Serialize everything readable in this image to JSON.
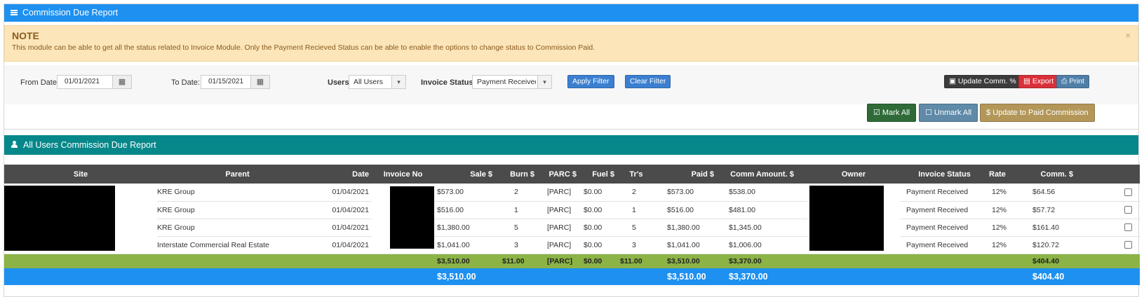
{
  "title": "Commission Due Report",
  "note": {
    "heading": "NOTE",
    "text": "This module can be able to get all the status related to Invoice Module. Only the Payment Recieved Status can be able to enable the options to change status to Commission Paid.",
    "close": "×"
  },
  "filters": {
    "from_label": "From Date:",
    "from_value": "01/01/2021",
    "to_label": "To Date:",
    "to_value": "01/15/2021",
    "users_label": "Users",
    "users_value": "All Users",
    "status_label": "Invoice Status",
    "status_value": "Payment Received",
    "apply": "Apply Filter",
    "clear": "Clear Filter",
    "update_comm": "Update Comm. %",
    "export": "Export",
    "print": "Print",
    "calendar_icon": "▦",
    "caret": "▾"
  },
  "actions": {
    "mark_all": "Mark All",
    "unmark_all": "Unmark All",
    "update_paid": "Update to Paid Commission"
  },
  "section_title": "All Users Commission Due Report",
  "table": {
    "headers": [
      "Site",
      "Parent",
      "Date",
      "Invoice No",
      "Sale $",
      "Burn $",
      "PARC $",
      "Fuel $",
      "Tr's",
      "Paid $",
      "Comm Amount. $",
      "Owner",
      "Invoice Status",
      "Rate",
      "Comm. $",
      ""
    ],
    "rows": [
      {
        "parent": "KRE Group",
        "date": "01/04/2021",
        "sale": "$573.00",
        "burn": "2",
        "parc": "[PARC]",
        "fuel": "$0.00",
        "trs": "2",
        "paid": "$573.00",
        "comm_amount": "$538.00",
        "status": "Payment Received",
        "rate": "12%",
        "comm": "$64.56"
      },
      {
        "parent": "KRE Group",
        "date": "01/04/2021",
        "sale": "$516.00",
        "burn": "1",
        "parc": "[PARC]",
        "fuel": "$0.00",
        "trs": "1",
        "paid": "$516.00",
        "comm_amount": "$481.00",
        "status": "Payment Received",
        "rate": "12%",
        "comm": "$57.72"
      },
      {
        "parent": "KRE Group",
        "date": "01/04/2021",
        "sale": "$1,380.00",
        "burn": "5",
        "parc": "[PARC]",
        "fuel": "$0.00",
        "trs": "5",
        "paid": "$1,380.00",
        "comm_amount": "$1,345.00",
        "status": "Payment Received",
        "rate": "12%",
        "comm": "$161.40"
      },
      {
        "parent": "Interstate Commercial Real Estate",
        "date": "01/04/2021",
        "sale": "$1,041.00",
        "burn": "3",
        "parc": "[PARC]",
        "fuel": "$0.00",
        "trs": "3",
        "paid": "$1,041.00",
        "comm_amount": "$1,006.00",
        "status": "Payment Received",
        "rate": "12%",
        "comm": "$120.72"
      }
    ],
    "subtotal": {
      "sale": "$3,510.00",
      "burn": "$11.00",
      "parc": "[PARC]",
      "fuel": "$0.00",
      "trs": "$11.00",
      "paid": "$3,510.00",
      "comm_amount": "$3,370.00",
      "comm": "$404.40"
    },
    "grand_total": {
      "sale": "$3,510.00",
      "paid": "$3,510.00",
      "comm_amount": "$3,370.00",
      "comm": "$404.40"
    }
  },
  "colors": {
    "header_blue": "#1e90f0",
    "section_teal": "#06878a",
    "note_bg": "#fbe5b9",
    "subtotal_green": "#8bb345",
    "table_head": "#4b4b4b"
  }
}
